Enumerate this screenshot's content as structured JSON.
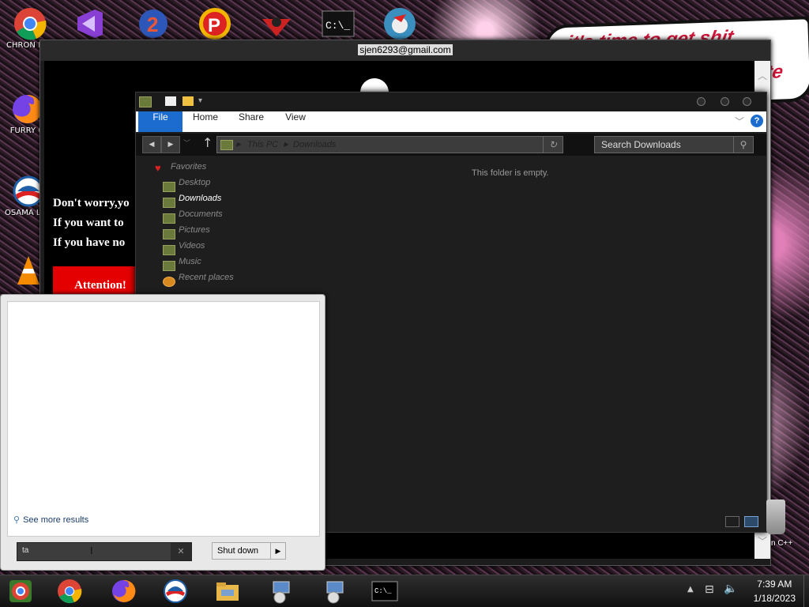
{
  "desktop": {
    "icons": [
      {
        "label": "CHRON DISEA"
      },
      {
        "label": "FURRY C"
      },
      {
        "label": "OSAMA LADEN E"
      }
    ],
    "wallpaper_text": "it's time to get shit",
    "wallpaper_text2": "te",
    "corner_label": "n C++"
  },
  "ransom_window": {
    "email": "sjen6293@gmail.com",
    "line1": "Don't worry,yo",
    "line2": "If you want to",
    "line3": "If you have no",
    "attention": "Attention!"
  },
  "explorer": {
    "tabs": [
      "File",
      "Home",
      "Share",
      "View"
    ],
    "address": {
      "root": "This PC",
      "folder": "Downloads"
    },
    "search_placeholder": "Search Downloads",
    "nav": {
      "favorites": "Favorites",
      "items": [
        "Desktop",
        "Downloads",
        "Documents",
        "Pictures",
        "Videos",
        "Music",
        "Recent places"
      ],
      "selected": "Downloads"
    },
    "empty_message": "This folder is empty."
  },
  "start_menu": {
    "see_more": "See more results",
    "search_value": "ta",
    "shutdown_label": "Shut down"
  },
  "taskbar": {
    "time": "7:39 AM",
    "date": "1/18/2023"
  },
  "colors": {
    "file_tab": "#1c6cd0",
    "attention_bg": "#e50000",
    "taskbar_bg": "#1a1a1a"
  }
}
